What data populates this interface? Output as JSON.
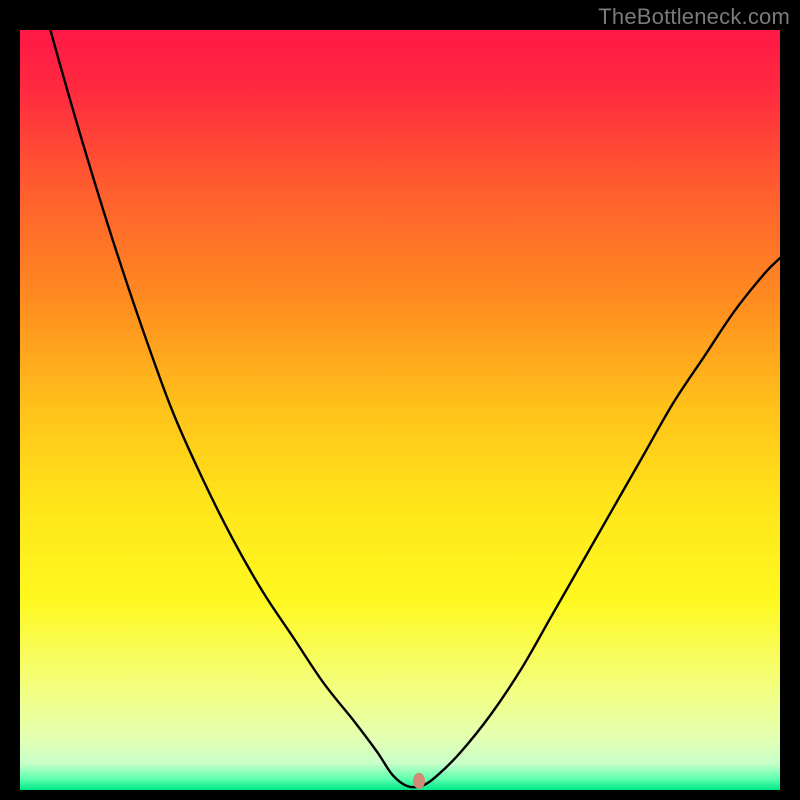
{
  "source_watermark": "TheBottleneck.com",
  "chart_data": {
    "type": "line",
    "title": "",
    "xlabel": "",
    "ylabel": "",
    "xlim": [
      0,
      100
    ],
    "ylim": [
      0,
      100
    ],
    "background_gradient": {
      "type": "vertical",
      "stops": [
        {
          "pos": 0.0,
          "color": "#ff1846"
        },
        {
          "pos": 0.08,
          "color": "#ff2a3f"
        },
        {
          "pos": 0.2,
          "color": "#ff5a2f"
        },
        {
          "pos": 0.35,
          "color": "#ff8a20"
        },
        {
          "pos": 0.5,
          "color": "#ffc21a"
        },
        {
          "pos": 0.62,
          "color": "#ffe41a"
        },
        {
          "pos": 0.75,
          "color": "#fff820"
        },
        {
          "pos": 0.86,
          "color": "#f4ff7a"
        },
        {
          "pos": 0.93,
          "color": "#e4ffb0"
        },
        {
          "pos": 0.965,
          "color": "#c8ffc8"
        },
        {
          "pos": 0.985,
          "color": "#60ffb0"
        },
        {
          "pos": 1.0,
          "color": "#00e888"
        }
      ]
    },
    "series": [
      {
        "name": "bottleneck-curve",
        "color": "#000000",
        "stroke_width": 2.4,
        "x": [
          0,
          4,
          8,
          12,
          16,
          20,
          24,
          28,
          32,
          36,
          40,
          44,
          47,
          49,
          51,
          53,
          55,
          58,
          62,
          66,
          70,
          74,
          78,
          82,
          86,
          90,
          94,
          98,
          100
        ],
        "y": [
          115,
          100,
          86,
          73,
          61,
          50,
          41,
          33,
          26,
          20,
          14,
          9,
          5,
          2,
          0.5,
          0.6,
          2,
          5,
          10,
          16,
          23,
          30,
          37,
          44,
          51,
          57,
          63,
          68,
          70
        ]
      }
    ],
    "marker": {
      "name": "optimum-point",
      "x": 52.5,
      "y": 1.2,
      "rx": 6,
      "ry": 8,
      "color": "#cf8a78"
    },
    "legend": null,
    "grid": false
  }
}
